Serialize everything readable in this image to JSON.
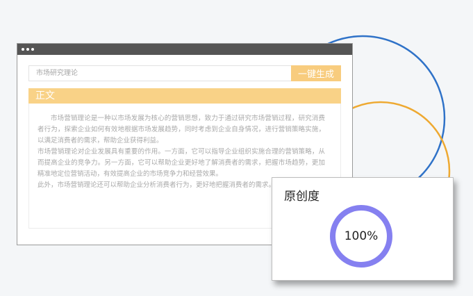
{
  "window": {
    "search": {
      "value": "",
      "placeholder": "市场研究理论"
    },
    "generate_label": "一键生成",
    "section_title": "正文",
    "paragraphs": [
      "市场营销理论是一种以市场发展为核心的营销思想，致力于通过研究市场营销过程，研究消费者行为，探索企业如何有效地根据市场发展趋势，同时考虑到企业自身情况，进行营销策略实施，以满足消费者的需求，帮助企业获得利益。",
      "市场营销理论对企业发展具有重要的作用。一方面，它可以指导企业组织实施合理的营销策略，从而提高企业的竞争力。另一方面，它可以帮助企业更好地了解消费者的需求，把握市场趋势，更加精准地定位营销活动，有效提高企业的市场竞争力和经营效果。",
      "此外，市场营销理论还可以帮助企业分析消费者行为，更好地把握消费者的需求。"
    ]
  },
  "originality": {
    "title": "原创度",
    "value_text": "100%",
    "value": 1.0
  },
  "colors": {
    "accent": "#f8cc7e",
    "ring": "#8580f0",
    "deco_blue": "#2f72c8",
    "deco_orange": "#eea931",
    "titlebar": "#555555"
  }
}
